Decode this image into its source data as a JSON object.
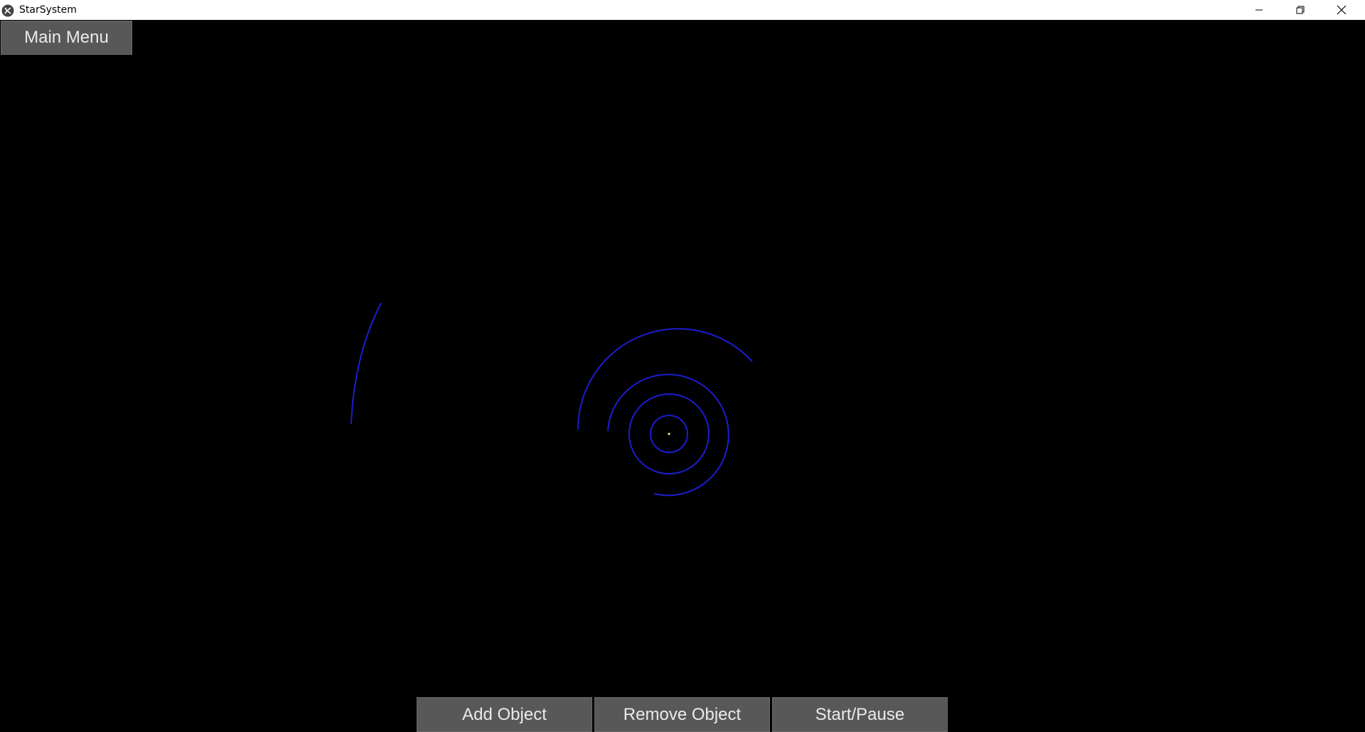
{
  "window": {
    "title": "StarSystem",
    "icon": "kivy-logo-icon",
    "controls": [
      "minimize-icon",
      "restore-icon",
      "close-icon"
    ]
  },
  "toolbar": {
    "main_menu_label": "Main Menu"
  },
  "bottom_bar": {
    "add_label": "Add Object",
    "remove_label": "Remove Object",
    "start_pause_label": "Start/Pause"
  },
  "simulation": {
    "orbit_color": "#1c1ccf",
    "star_color": "#ffff99",
    "background": "#000000"
  }
}
